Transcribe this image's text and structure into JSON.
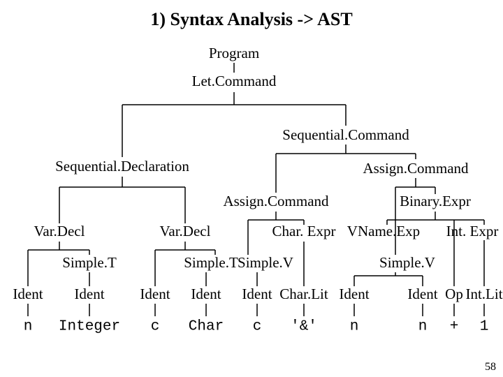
{
  "title": "1) Syntax Analysis -> AST",
  "page_number": "58",
  "nodes": {
    "program": "Program",
    "letcmd": "Let.Command",
    "seqcmd": "Sequential.Command",
    "seqdecl": "Sequential.Declaration",
    "assigncmd_r": "Assign.Command",
    "assigncmd_l": "Assign.Command",
    "binexpr": "Binary.Expr",
    "vardecl_l": "Var.Decl",
    "vardecl_r": "Var.Decl",
    "charexpr": "Char. Expr",
    "vnameexp": "VName.Exp",
    "intexpr": "Int. Expr",
    "simplet_l": "Simple.T",
    "simplet_r": "Simple.T",
    "simplev_l": "Simple.V",
    "simplev_r": "Simple.V",
    "ident1": "Ident",
    "ident2": "Ident",
    "ident3": "Ident",
    "ident4": "Ident",
    "ident5": "Ident",
    "charlit": "Char.Lit",
    "ident6": "Ident",
    "ident7": "Ident",
    "op": "Op",
    "intlit": "Int.Lit"
  },
  "leaves": {
    "n1": "n",
    "integer": "Integer",
    "c1": "c",
    "char": "Char",
    "c2": "c",
    "amp": "'&'",
    "n2": "n",
    "n3": "n",
    "plus": "+",
    "one": "1"
  }
}
